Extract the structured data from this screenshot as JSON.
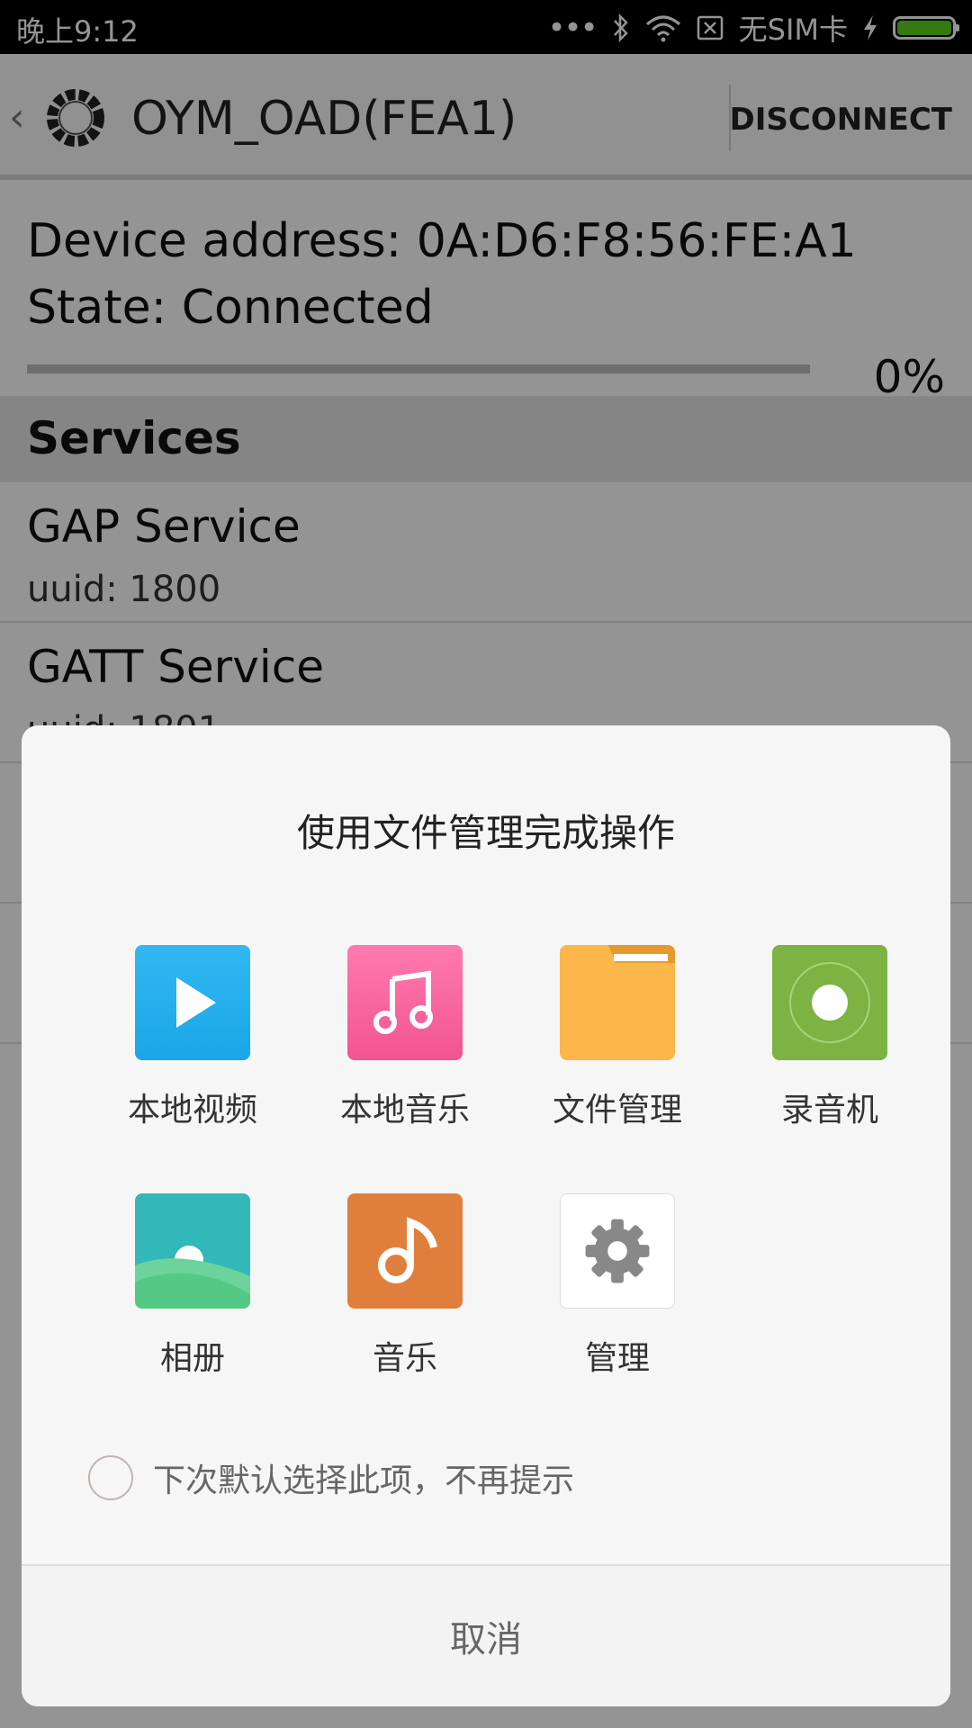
{
  "status_bar": {
    "time": "晚上9:12",
    "dots": "•••",
    "sim": "无SIM卡",
    "battery_color": "#5bd21d"
  },
  "app_bar": {
    "title": "OYM_OAD(FEA1)",
    "action": "DISCONNECT"
  },
  "device": {
    "address": "Device address: 0A:D6:F8:56:FE:A1",
    "state": "State: Connected",
    "progress_percent": "0%"
  },
  "services": {
    "header": "Services",
    "items": [
      {
        "name": "GAP Service",
        "uuid": "uuid: 1800"
      },
      {
        "name": "GATT Service",
        "uuid": "uuid: 1801"
      }
    ]
  },
  "dialog": {
    "title": "使用文件管理完成操作",
    "apps": [
      {
        "label": "本地视频",
        "icon": "video-play-icon"
      },
      {
        "label": "本地音乐",
        "icon": "music-note-icon"
      },
      {
        "label": "文件管理",
        "icon": "folder-icon"
      },
      {
        "label": "录音机",
        "icon": "recorder-icon"
      },
      {
        "label": "相册",
        "icon": "gallery-icon"
      },
      {
        "label": "音乐",
        "icon": "music-app-icon"
      },
      {
        "label": "管理",
        "icon": "gear-icon"
      }
    ],
    "default_checkbox_label": "下次默认选择此项，不再提示",
    "cancel": "取消"
  }
}
